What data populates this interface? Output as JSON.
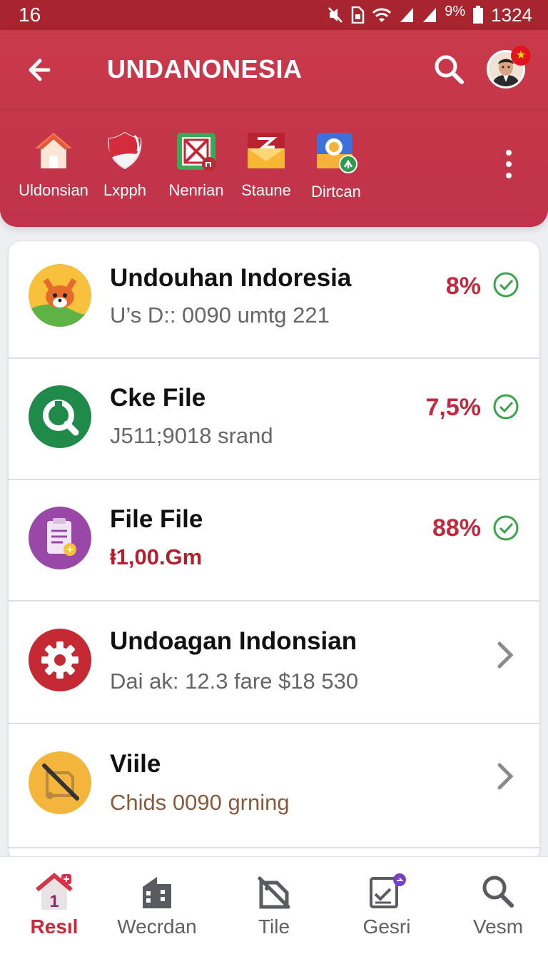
{
  "status_bar": {
    "left_text": "16",
    "battery_text": "%",
    "time": "1324"
  },
  "header": {
    "title": "UNDANONESIA",
    "back_icon": "arrow-left-icon",
    "search_icon": "search-icon",
    "more_icon": "more-vertical-icon",
    "shortcuts": [
      {
        "label": "Uldonsian",
        "icon": "home-icon"
      },
      {
        "label": "Lxpph",
        "icon": "shield-icon"
      },
      {
        "label": "Nenrian",
        "icon": "image-frame-icon"
      },
      {
        "label": "Staune",
        "icon": "mail-icon"
      },
      {
        "label": "Dirtcan",
        "icon": "contacts-icon"
      }
    ]
  },
  "list": {
    "items": [
      {
        "title": "Undouhan Indoresia",
        "subtitle": "U’s D:: 0090 umtg 221",
        "percent": "8%",
        "status_icon": "check-circle-icon",
        "icon": "fox-avatar-icon"
      },
      {
        "title": "Cke File",
        "subtitle": "J511;9018 srand",
        "percent": "7,5%",
        "status_icon": "check-circle-icon",
        "icon": "magnifier-icon"
      },
      {
        "title": "File File",
        "subtitle": "ⱡ1,00.Gm",
        "percent": "88%",
        "status_icon": "check-circle-icon",
        "icon": "clipboard-icon"
      },
      {
        "title": "Undoagan Indonsian",
        "subtitle": "Dai ak: 12.3 fare $18 530",
        "status_icon": "chevron-right-icon",
        "icon": "gear-icon"
      },
      {
        "title": "Viile",
        "subtitle": "Chids 0090 grning",
        "status_icon": "chevron-right-icon",
        "icon": "no-tag-icon"
      }
    ]
  },
  "bottom_nav": {
    "items": [
      {
        "label": "Resıl",
        "icon": "home-badge-icon",
        "badge": "1",
        "active": true
      },
      {
        "label": "Wecrdan",
        "icon": "building-icon"
      },
      {
        "label": "Tile",
        "icon": "tag-off-icon"
      },
      {
        "label": "Gesri",
        "icon": "checklist-icon"
      },
      {
        "label": "Vesm",
        "icon": "search-icon"
      }
    ]
  },
  "colors": {
    "primary": "#c6364a",
    "status_bar": "#a8242f",
    "percent_text": "#c12a3e",
    "check_green": "#3aa44a",
    "subtitle_red": "#b21f2f",
    "subtitle_brown": "#8a5a3a",
    "active_nav": "#c8283a"
  }
}
